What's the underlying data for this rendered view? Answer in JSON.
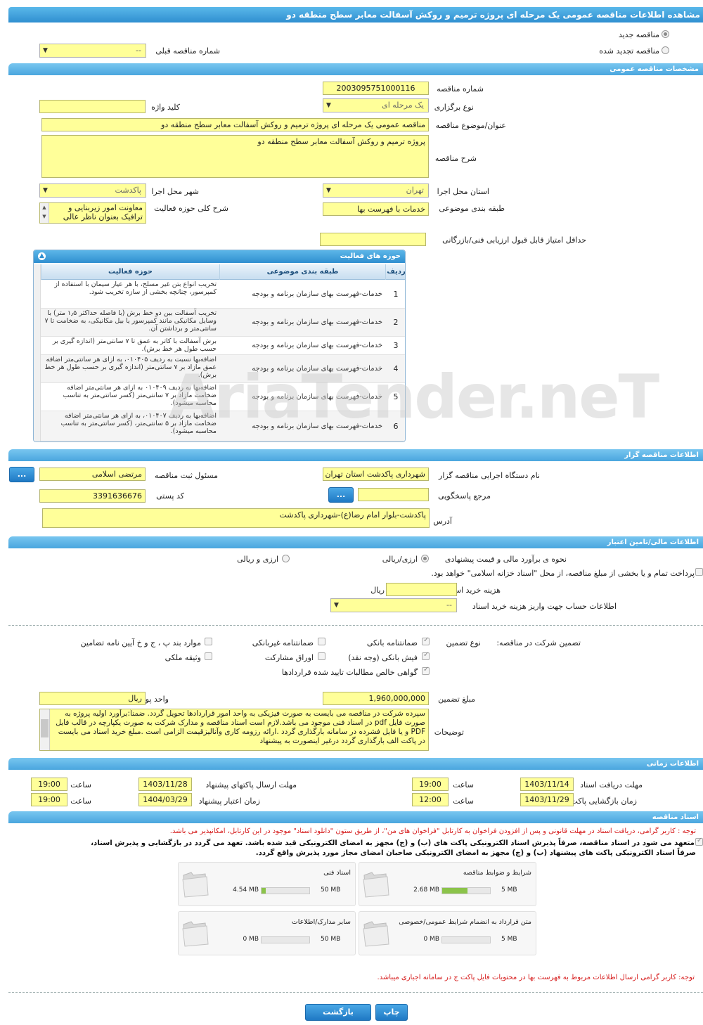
{
  "page_title": "مشاهده اطلاعات مناقصه عمومی یک مرحله ای پروژه ترمیم و روکش آسفالت معابر سطح منطقه دو",
  "tender_type": {
    "new_label": "مناقصه جدید",
    "renewed_label": "مناقصه تجدید شده",
    "prev_number_label": "شماره مناقصه قبلی",
    "prev_number_value": "--"
  },
  "general": {
    "section_title": "مشخصات مناقصه عمومی",
    "number_label": "شماره مناقصه",
    "number_value": "2003095751000116",
    "holding_type_label": "نوع برگزاری",
    "holding_type_value": "یک مرحله ای",
    "keyword_label": "کلید واژه",
    "keyword_value": "",
    "subject_label": "عنوان/موضوع مناقصه",
    "subject_value": "مناقصه عمومی یک مرحله ای پروژه ترمیم  و روکش آسفالت معابر سطح منطقه دو",
    "description_label": "شرح مناقصه",
    "description_value": "پروژه ترمیم  و روکش آسفالت معابر سطح منطقه دو",
    "province_label": "استان محل اجرا",
    "province_value": "تهران",
    "city_label": "شهر محل اجرا",
    "city_value": "پاکدشت",
    "category_label": "طبقه بندی موضوعی",
    "category_value": "خدمات با فهرست بها",
    "activity_scope_label": "شرح کلی حوزه فعالیت",
    "activity_scope_value": "معاونت امور زیربنایی و ترافیک بعنوان ناظر عالی",
    "min_score_label": "حداقل امتیاز قابل قبول ارزیابی فنی/بازرگانی",
    "min_score_value": ""
  },
  "activities": {
    "title": "حوزه های فعالیت",
    "col_row": "ردیف",
    "col_category": "طبقه بندی موضوعی",
    "col_activity": "حوزه فعالیت",
    "rows": [
      {
        "no": "1",
        "category": "خدمات-فهرست بهای سازمان برنامه و بودجه",
        "activity": "تخریب انواع بتن غیر مسلح، با هر عیار سیمان با استفاده از کمپرسور، چنانچه بخشی از سازه تخریب شود."
      },
      {
        "no": "2",
        "category": "خدمات-فهرست بهای سازمان برنامه و بودجه",
        "activity": "تخریب آسفالت بین دو خط برش (با فاصله حداکثر ۱٫۵ متر) با وسایل مکانیکی مانند کمپرسور یا بیل مکانیکی، به ضخامت تا ۷ سانتی‌متر و برداشتن آن."
      },
      {
        "no": "3",
        "category": "خدمات-فهرست بهای سازمان برنامه و بودجه",
        "activity": "برش آسفالت با کاتر به عمق تا  ۷ سانتی‌متر (اندازه گیری بر حسب طول هر خط برش)."
      },
      {
        "no": "4",
        "category": "خدمات-فهرست بهای سازمان برنامه و بودجه",
        "activity": "اضافه‌بها نسبت به ردیف ۰۱۰۴۰۵، به ازای هر سانتی‌متر اضافه عمق مازاد بر  ۷ سانتی‌متر (اندازه گیری بر حسب طول هر خط برش)."
      },
      {
        "no": "5",
        "category": "خدمات-فهرست بهای سازمان برنامه و بودجه",
        "activity": "اضافه‌بها به ردیف ۰۱۰۴۰۹ به ازای هر سانتی‌متر اضافه ضخامت مازاد بر ۷ سانتی‌متر (کسر سانتی‌متر به تناسب محاسبه میشود)."
      },
      {
        "no": "6",
        "category": "خدمات-فهرست بهای سازمان برنامه و بودجه",
        "activity": "اضافه‌بها به ردیف ۰۱۰۴۰۷، به ازای هر سانتی‌متر اضافه ضخامت مازاد بر ۵ سانتی‌متر، (کسر سانتی‌متر به تناسب محاسبه میشود)."
      }
    ]
  },
  "organizer": {
    "section_title": "اطلاعات مناقصه گزار",
    "org_label": "نام دستگاه اجرایی مناقصه گزار",
    "org_value": "شهرداری پاکدشت استان تهران",
    "registrar_label": "مسئول ثبت مناقصه",
    "registrar_value": "مرتضی اسلامی",
    "dots_label": "...",
    "reference_label": "مرجع پاسخگویی",
    "reference_value": "",
    "postal_label": "کد پستی",
    "postal_value": "3391636676",
    "address_label": "آدرس",
    "address_value": "پاکدشت-بلوار امام رضا(ع)-شهرداری پاکدشت"
  },
  "finance": {
    "section_title": "اطلاعات مالی/تامین اعتبار",
    "estimate_label": "نحوه ی برآورد مالی و قیمت پیشنهادی",
    "estimate_opt1": "ارزی/ریالی",
    "estimate_opt2": "ارزی و ریالی",
    "treasury_text": "پرداخت تمام و یا بخشی از مبلغ مناقصه، از محل \"اسناد خزانه اسلامی\" خواهد بود.",
    "doc_cost_label": "هزینه خرید اسناد",
    "doc_cost_value": "",
    "doc_cost_unit": "ریال",
    "account_label": "اطلاعات حساب جهت واریز هزینه خرید اسناد",
    "account_value": "--"
  },
  "guarantee": {
    "title_label": "تضمین شرکت در مناقصه:",
    "type_label": "نوع تضمین",
    "opt_bank_guarantee": "ضمانتنامه بانکی",
    "opt_nonbank_guarantee": "ضمانتنامه غیربانکی",
    "opt_clause": "موارد بند پ ، ج و خ آیین نامه تضامین",
    "opt_bank_check": "فیش بانکی (وجه نقد)",
    "opt_bonds": "اوراق مشارکت",
    "opt_property": "وثیقه ملکی",
    "opt_claims": "گواهی خالص مطالبات تایید شده قراردادها",
    "amount_label": "مبلغ تضمین",
    "amount_value": "1,960,000,000",
    "currency_label": "واحد پول",
    "currency_value": "ریال",
    "notes_label": "توضیحات",
    "notes_value": "سپرده شرکت در مناقصه می بایست به صورت فیزیکی به واحد امور قراردادها تحویل گردد. ضمناً:برآورد اولیه پروژه به صورت فایل pdf  در اسناد فنی موجود می باشد.لازم است اسناد مناقصه و مدارک شرکت به صورت یکپارچه در قالب فایل PDF  و یا  فایل فشرده در سامانه بارگذاری گردد .ارائه رزومه کاری وآنالیزقیمت الزامی است .مبلغ خرید اسناد می بایست در پاکت الف بارگذاری گردد درغیر اینصورت به پیشنهاد"
  },
  "timing": {
    "section_title": "اطلاعات زمانی",
    "receive_label": "مهلت دریافت اسناد",
    "receive_date": "1403/11/14",
    "receive_time": "19:00",
    "submit_label": "مهلت ارسال پاکتهای پیشنهاد",
    "submit_date": "1403/11/28",
    "submit_time": "19:00",
    "open_label": "زمان بازگشایی پاکت ها",
    "open_date": "1403/11/29",
    "open_time": "12:00",
    "validity_label": "زمان اعتبار پیشنهاد",
    "validity_date": "1404/03/29",
    "validity_time": "19:00",
    "time_label": "ساعت"
  },
  "documents": {
    "section_title": "اسناد مناقصه",
    "notice_red": "توجه : کاربر گرامی، دریافت اسناد در مهلت قانونی و پس از افزودن فراخوان به کارتابل \"فراخوان های من\"، از طریق ستون \"دانلود اسناد\" موجود در این کارتابل، امکانپذیر می باشد.",
    "commit_text_1": "متعهد می شود در اسناد مناقصه، صرفاً پذیرش اسناد الکترونیکی پاکت های (ب) و (ج) مجهز به امضای الکترونیکی قید شده باشد. تعهد می گردد در بازگشایی و پذیرش اسناد،",
    "commit_text_2": "صرفاً اسناد الکترونیکی پاکت های پیشنهاد (ب) و (ج) مجهز به امضای الکترونیکی صاحبان امضای مجاز مورد پذیرش واقع گردد.",
    "cards": [
      {
        "title": "شرایط و ضوابط مناقصه",
        "used": "2.68 MB",
        "max": "5 MB",
        "percent": 53.6
      },
      {
        "title": "اسناد فنی",
        "used": "4.54 MB",
        "max": "50 MB",
        "percent": 9.1
      },
      {
        "title": "متن قرارداد به انضمام شرایط عمومی/خصوصی",
        "used": "0 MB",
        "max": "5 MB",
        "percent": 0
      },
      {
        "title": "سایر مدارک/اطلاعات",
        "used": "0 MB",
        "max": "50 MB",
        "percent": 0
      }
    ],
    "notice_bottom": "توجه: کاربر گرامی ارسال اطلاعات مربوط به فهرست بها در محتویات فایل پاکت ج در سامانه اجباری میباشد."
  },
  "buttons": {
    "print": "چاپ",
    "back": "بازگشت"
  },
  "watermark": "AriaTender.neT",
  "colors": {
    "header_blue": "#2f8fd0",
    "field_yellow": "#ffff99",
    "notice_red": "#d61c1c",
    "progress_green": "#8bc34a"
  }
}
